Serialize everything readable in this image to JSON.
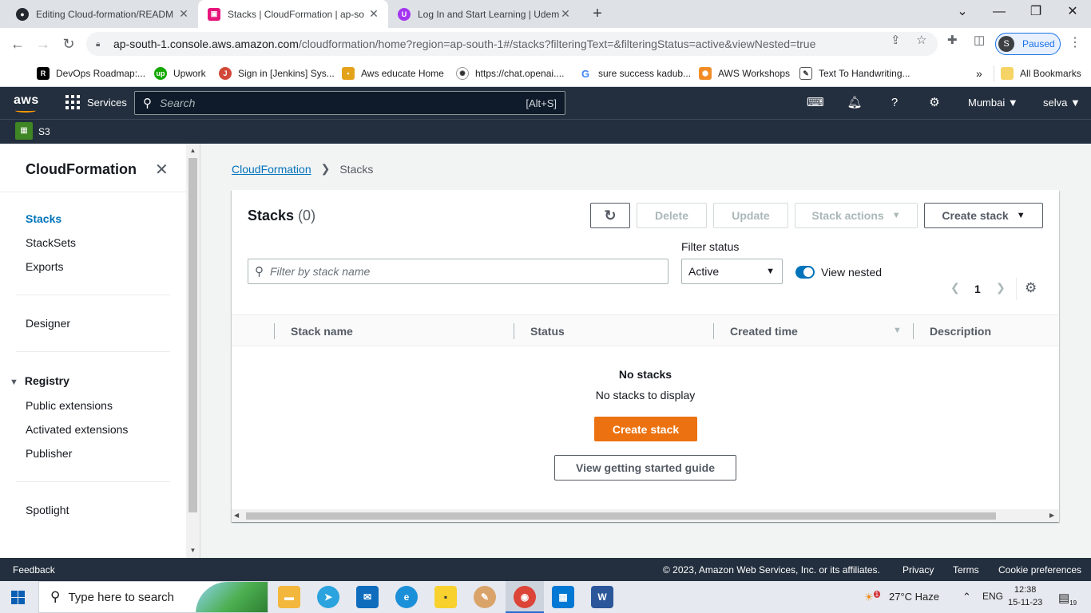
{
  "browser": {
    "tabs": [
      {
        "title": "Editing Cloud-formation/READM",
        "icon": "github-icon"
      },
      {
        "title": "Stacks | CloudFormation | ap-so",
        "icon": "cloudformation-icon"
      },
      {
        "title": "Log In and Start Learning | Udem",
        "icon": "udemy-icon"
      }
    ],
    "url_host": "ap-south-1.console.aws.amazon.com",
    "url_rest": "/cloudformation/home?region=ap-south-1#/stacks?filteringText=&filteringStatus=active&viewNested=true",
    "profile_initial": "S",
    "profile_status": "Paused",
    "bookmarks": [
      "DevOps Roadmap:...",
      "Upwork",
      "Sign in [Jenkins] Sys...",
      "Aws educate Home",
      "https://chat.openai....",
      "sure success kadub...",
      "AWS Workshops",
      "Text To Handwriting..."
    ],
    "all_bookmarks": "All Bookmarks",
    "overflow": "»"
  },
  "aws": {
    "logo": "aws",
    "services": "Services",
    "search_placeholder": "Search",
    "search_shortcut": "[Alt+S]",
    "region": "Mumbai",
    "user": "selva",
    "pinned_service": "S3"
  },
  "sidenav": {
    "title": "CloudFormation",
    "items": [
      "Stacks",
      "StackSets",
      "Exports"
    ],
    "designer": "Designer",
    "registry_header": "Registry",
    "registry_items": [
      "Public extensions",
      "Activated extensions",
      "Publisher"
    ],
    "spotlight": "Spotlight"
  },
  "breadcrumb": {
    "root": "CloudFormation",
    "current": "Stacks"
  },
  "stacks_panel": {
    "title": "Stacks",
    "count": "(0)",
    "delete": "Delete",
    "update": "Update",
    "stack_actions": "Stack actions",
    "create_stack": "Create stack",
    "filter_placeholder": "Filter by stack name",
    "filter_status_label": "Filter status",
    "filter_status_value": "Active",
    "view_nested": "View nested",
    "view_nested_on": true,
    "page": "1",
    "columns": [
      "Stack name",
      "Status",
      "Created time",
      "Description"
    ],
    "empty_title": "No stacks",
    "empty_sub": "No stacks to display",
    "empty_create": "Create stack",
    "guide": "View getting started guide"
  },
  "footer": {
    "feedback": "Feedback",
    "copyright": "© 2023, Amazon Web Services, Inc. or its affiliates.",
    "privacy": "Privacy",
    "terms": "Terms",
    "cookies": "Cookie preferences"
  },
  "taskbar": {
    "search_placeholder": "Type here to search",
    "weather": "27°C  Haze",
    "lang": "ENG",
    "time": "12:38",
    "date": "15-11-23",
    "notif_count": "19",
    "weather_badge": "1"
  },
  "colors": {
    "aws_nav": "#232f3e",
    "aws_orange": "#ec7211",
    "link_blue": "#0073bb"
  }
}
